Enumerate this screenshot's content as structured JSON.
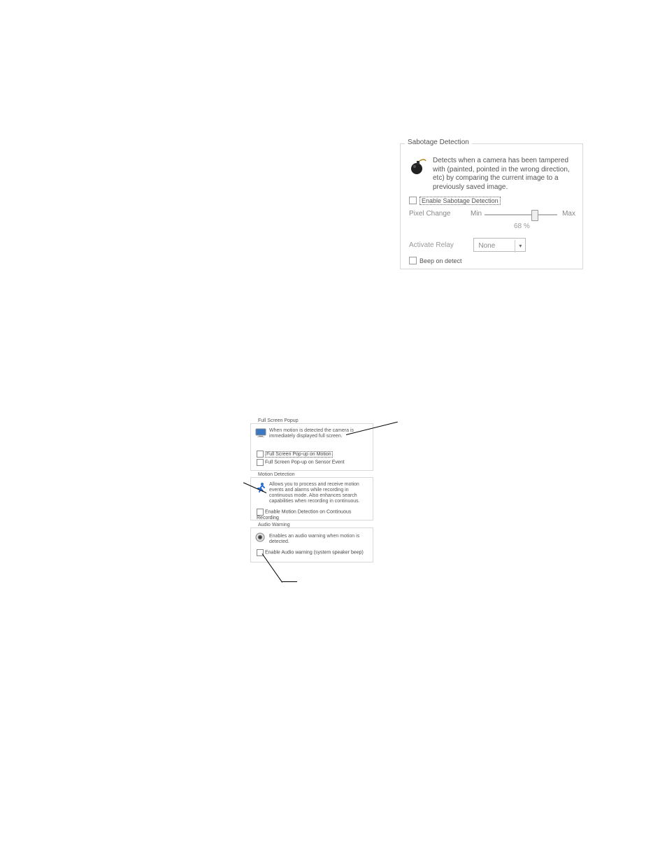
{
  "sabotage": {
    "title": "Sabotage Detection",
    "description": "Detects when a camera has been tampered with (painted, pointed in the wrong direction, etc) by comparing the current image to a previously saved image.",
    "enable_label": "Enable Sabotage Detection",
    "enable_checked": false,
    "pixel_change_label": "Pixel Change",
    "min_label": "Min",
    "max_label": "Max",
    "percent_value": "68 %",
    "activate_relay_label": "Activate Relay",
    "relay_value": "None",
    "beep_label": "Beep on detect",
    "beep_checked": false
  },
  "fullscreen": {
    "title": "Full Screen Popup",
    "description": "When motion is detected the camera is immediately displayed full screen.",
    "cb1_label": "Full Screen Pop-up on Motion",
    "cb1_checked": false,
    "cb2_label": "Full Screen Pop-up on Sensor Event",
    "cb2_checked": false
  },
  "motion": {
    "title": "Motion Detection",
    "description": "Allows you to process and receive motion events and alarms while recording in continuous mode. Also enhances search capabilities when recording in continuous.",
    "cb_label": "Enable Motion Detection on Continuous Recording",
    "cb_checked": false
  },
  "audio": {
    "title": "Audio Warning",
    "description": "Enables an audio warning when motion is detected.",
    "cb_label": "Enable Audio warning (system speaker beep)",
    "cb_checked": false
  }
}
